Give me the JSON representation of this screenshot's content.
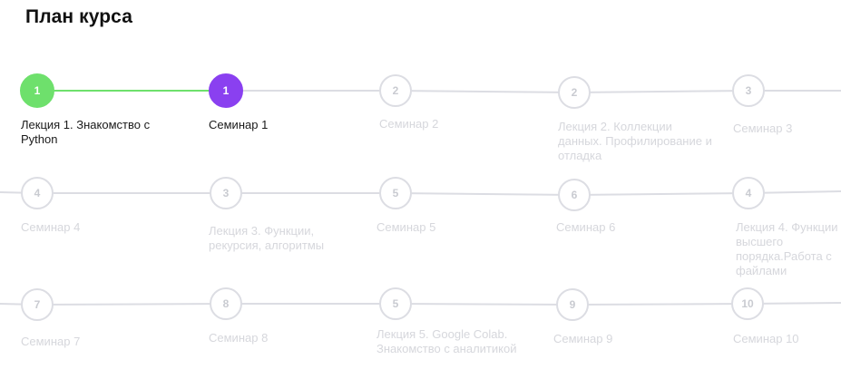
{
  "page": {
    "title": "План курса"
  },
  "colors": {
    "done": "#6ee06c",
    "current": "#8a40f0",
    "inactive_line": "#dcdde3",
    "inactive_text": "#d6d7dc"
  },
  "steps": [
    {
      "number": "1",
      "label": "Лекция 1. Знакомство с Python",
      "status": "done"
    },
    {
      "number": "1",
      "label": "Семинар 1",
      "status": "current"
    },
    {
      "number": "2",
      "label": "Семинар 2",
      "status": "locked"
    },
    {
      "number": "2",
      "label": "Лекция 2. Коллекции данных. Профилирование и отладка",
      "status": "locked"
    },
    {
      "number": "3",
      "label": "Семинар 3",
      "status": "locked"
    },
    {
      "number": "4",
      "label": "Семинар 4",
      "status": "locked"
    },
    {
      "number": "3",
      "label": "Лекция 3. Функции, рекурсия, алгоритмы",
      "status": "locked"
    },
    {
      "number": "5",
      "label": "Семинар 5",
      "status": "locked"
    },
    {
      "number": "6",
      "label": "Семинар 6",
      "status": "locked"
    },
    {
      "number": "4",
      "label": "Лекция 4. Функции высшего порядка.Работа с файлами",
      "status": "locked"
    },
    {
      "number": "7",
      "label": "Семинар 7",
      "status": "locked"
    },
    {
      "number": "8",
      "label": "Семинар 8",
      "status": "locked"
    },
    {
      "number": "5",
      "label": "Лекция 5. Google Colab. Знакомство с аналитикой",
      "status": "locked"
    },
    {
      "number": "9",
      "label": "Семинар 9",
      "status": "locked"
    },
    {
      "number": "10",
      "label": "Семинар 10",
      "status": "locked"
    }
  ]
}
